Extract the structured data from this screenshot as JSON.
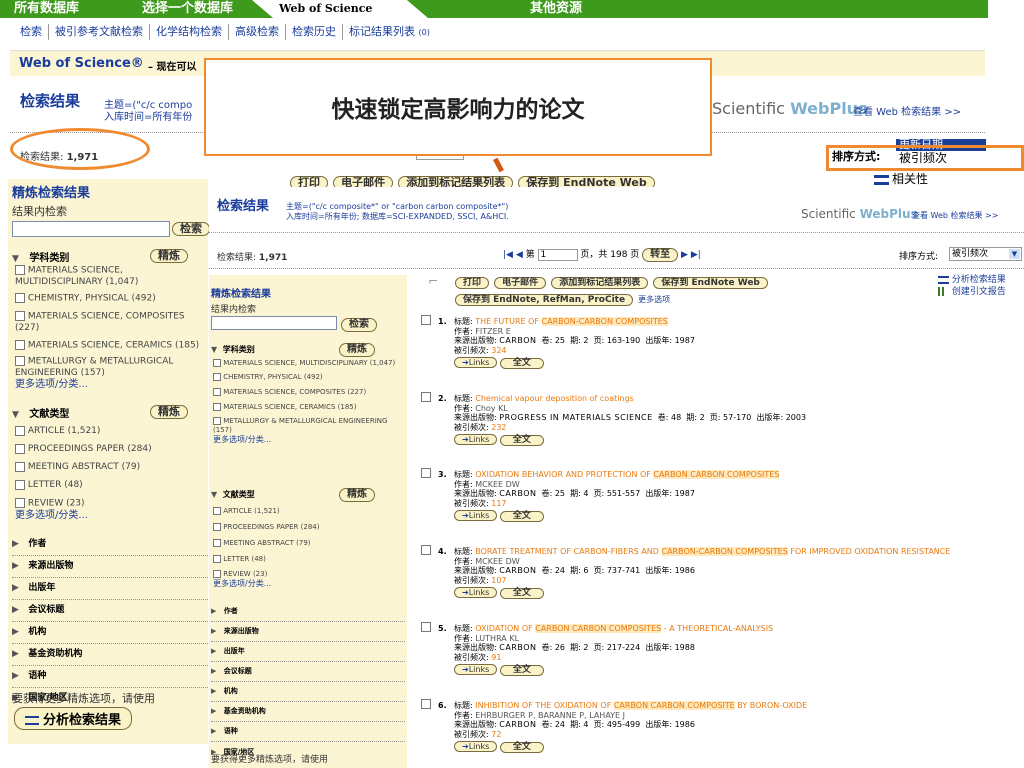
{
  "top_tabs": [
    "所有数据库",
    "选择一个数据库",
    "Web of Science",
    "其他资源"
  ],
  "nav": [
    "检索",
    "被引参考文献检索",
    "化学结构检索",
    "高级检索",
    "检索历史",
    "标记结果列表"
  ],
  "marked_count": "(0)",
  "wos_title": "Web of Science®",
  "wos_title_suffix": " – 现在可以",
  "search_results_heading": "检索结果",
  "topic_query": "主题=(\"c/c compo",
  "time_span": "入库时间=所有年份",
  "callout_text": "快速锁定高影响力的论文",
  "scientific": "Scientific",
  "webplus": "WebPlus",
  "view_web_results": "查看 Web 检索结果 >>",
  "result_count_label": "检索结果:",
  "result_count": "1,971",
  "sort_label": "排序方式:",
  "sort_options": [
    "更新日期",
    "被引频次",
    "相关性"
  ],
  "buttons": [
    "打印",
    "电子邮件",
    "添加到标记结果列表",
    "保存到 EndNote Web"
  ],
  "refine_title": "精炼检索结果",
  "within_results": "结果内检索",
  "search_btn": "检索",
  "refine_btn": "精炼",
  "subject_heading": "学科类别",
  "subjects": [
    "MATERIALS SCIENCE, MULTIDISCIPLINARY (1,047)",
    "CHEMISTRY, PHYSICAL (492)",
    "MATERIALS SCIENCE, COMPOSITES (227)",
    "MATERIALS SCIENCE, CERAMICS (185)",
    "METALLURGY & METALLURGICAL ENGINEERING (157)"
  ],
  "more_options": "更多选项/分类...",
  "doctype_heading": "文献类型",
  "doctypes": [
    "ARTICLE (1,521)",
    "PROCEEDINGS PAPER (284)",
    "MEETING ABSTRACT (79)",
    "LETTER (48)",
    "REVIEW (23)"
  ],
  "facets": [
    "作者",
    "来源出版物",
    "出版年",
    "会议标题",
    "机构",
    "基金资助机构",
    "语种",
    "国家/地区"
  ],
  "more_refine_note": "要获得更多精炼选项，请使用",
  "analyze_btn": "分析检索结果",
  "inner_topic": "主题=(\"c/c composite*\" or \"carbon carbon composite*\")",
  "inner_time": "入库时间=所有年份; 数据库=SCI-EXPANDED, SSCI, A&HCI.",
  "pager_page": "第",
  "pager_current": "1",
  "pager_total": "页，共 198 页",
  "goto_btn": "转至",
  "inner_sort_value": "被引频次",
  "save_more": "保存到 EndNote, RefMan, ProCite",
  "more_options_link": "更多选项",
  "analyze_results": "分析检索结果",
  "create_citation_report": "创建引文报告",
  "links_btn": "Links",
  "fulltext_btn": "全文",
  "labels": {
    "title": "标题:",
    "author": "作者:",
    "source": "来源出版物:",
    "vol": "卷:",
    "issue": "期:",
    "page": "页:",
    "year": "出版年:",
    "cited": "被引频次:"
  },
  "results": [
    {
      "n": "1.",
      "title_pre": "THE FUTURE OF ",
      "title_hl": "CARBON-CARBON COMPOSITES",
      "title_post": "",
      "author": "FITZER E",
      "source": "CARBON",
      "vol": "25",
      "issue": "2",
      "pages": "163-190",
      "year": "1987",
      "cited": "324"
    },
    {
      "n": "2.",
      "title_pre": "Chemical vapour deposition of coatings",
      "title_hl": "",
      "title_post": "",
      "author": "Choy KL",
      "source": "PROGRESS IN MATERIALS SCIENCE",
      "vol": "48",
      "issue": "2",
      "pages": "57-170",
      "year": "2003",
      "cited": "232"
    },
    {
      "n": "3.",
      "title_pre": "OXIDATION BEHAVIOR AND PROTECTION OF ",
      "title_hl": "CARBON CARBON COMPOSITES",
      "title_post": "",
      "author": "MCKEE DW",
      "source": "CARBON",
      "vol": "25",
      "issue": "4",
      "pages": "551-557",
      "year": "1987",
      "cited": "117"
    },
    {
      "n": "4.",
      "title_pre": "BORATE TREATMENT OF CARBON-FIBERS AND ",
      "title_hl": "CARBON-CARBON COMPOSITES",
      "title_post": " FOR IMPROVED OXIDATION RESISTANCE",
      "author": "MCKEE DW",
      "source": "CARBON",
      "vol": "24",
      "issue": "6",
      "pages": "737-741",
      "year": "1986",
      "cited": "107"
    },
    {
      "n": "5.",
      "title_pre": "OXIDATION OF ",
      "title_hl": "CARBON CARBON COMPOSITES",
      "title_post": " - A THEORETICAL-ANALYSIS",
      "author": "LUTHRA KL",
      "source": "CARBON",
      "vol": "26",
      "issue": "2",
      "pages": "217-224",
      "year": "1988",
      "cited": "91"
    },
    {
      "n": "6.",
      "title_pre": "INHIBITION OF THE OXIDATION OF ",
      "title_hl": "CARBON CARBON COMPOSITE",
      "title_post": " BY BORON-OXIDE",
      "author": "EHRBURGER P, BARANNE P, LAHAYE J",
      "source": "CARBON",
      "vol": "24",
      "issue": "4",
      "pages": "495-499",
      "year": "1986",
      "cited": "72"
    }
  ]
}
